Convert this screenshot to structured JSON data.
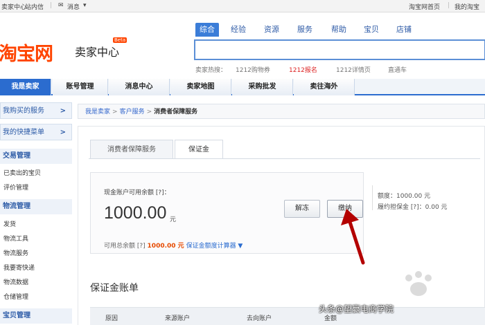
{
  "topbar": {
    "left": [
      "卖家中心",
      "站内信"
    ],
    "message_label": "消息",
    "right": [
      "淘宝网首页",
      "我的淘宝"
    ]
  },
  "brand": {
    "logo_text": "淘宝网",
    "subtitle": "卖家中心",
    "badge": "Beta"
  },
  "search": {
    "tabs": [
      "综合",
      "经验",
      "资源",
      "服务",
      "帮助",
      "宝贝",
      "店铺"
    ],
    "active_tab": "综合",
    "value": "",
    "hot_label": "卖家热搜：",
    "hot_words": [
      "1212购物券",
      "1212报名",
      "1212详情页",
      "直通车"
    ]
  },
  "nav": {
    "items": [
      "我是卖家",
      "账号管理",
      "消息中心",
      "卖家地图",
      "采购批发",
      "卖往海外"
    ],
    "active": "我是卖家"
  },
  "sidebar": {
    "headers": [
      "我购买的服务",
      "我的快捷菜单"
    ],
    "sections": [
      {
        "title": "交易管理",
        "links": [
          "已卖出的宝贝",
          "评价管理"
        ]
      },
      {
        "title": "物流管理",
        "links": [
          "发货",
          "物流工具",
          "物流服务",
          "我要寄快递",
          "物流数据",
          "仓储管理"
        ]
      },
      {
        "title": "宝贝管理",
        "links": []
      }
    ]
  },
  "breadcrumb": {
    "items": [
      "我是卖家",
      "客户服务"
    ],
    "current": "消费者保障服务"
  },
  "tabs": [
    "消费者保障服务",
    "保证金"
  ],
  "active_tab": "保证金",
  "balance": {
    "label": "现金账户可用余额 [?]：",
    "amount": "1000.00",
    "unit": "元",
    "unfreeze_button": "解冻",
    "pay_button": "缴纳",
    "total_label": "可用总余额 [?]",
    "total_amount": "1000.00 元",
    "calculator_link": "保证金额度计算器 ▼"
  },
  "quota": {
    "line1": "额度：1000.00 元",
    "line2": "履约担保金 [?]：0.00 元"
  },
  "ledger": {
    "title": "保证金账单",
    "columns": [
      "原因",
      "来源账户",
      "去向账户",
      "金额"
    ]
  },
  "watermark": {
    "text": "头条@望赢电商学院"
  },
  "colors": {
    "brand_orange": "#ff4400",
    "nav_blue": "#2b6ccf",
    "annotation_red": "#b30000"
  }
}
